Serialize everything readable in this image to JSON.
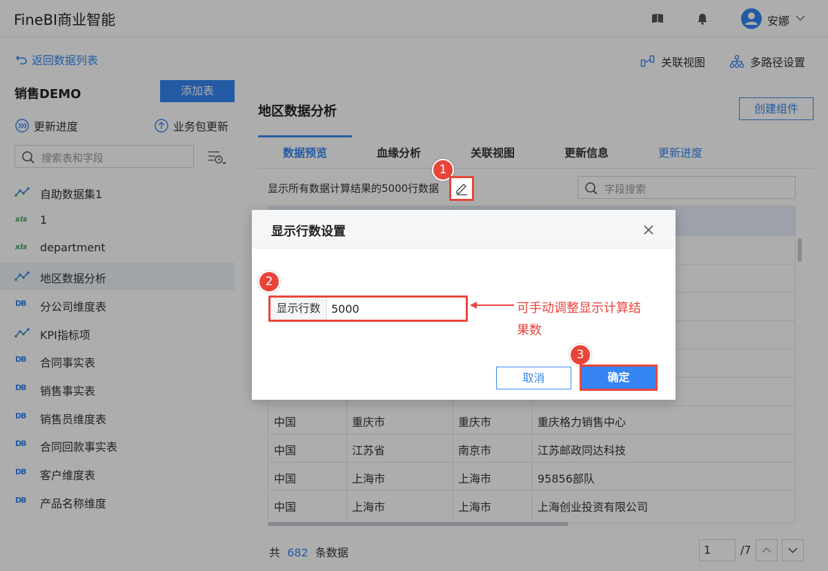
{
  "app": {
    "brand": "FineBI商业智能",
    "user": "安娜"
  },
  "subbar": {
    "back_label": "返回数据列表",
    "relation_view": "关联视图",
    "multipath": "多路径设置"
  },
  "sidebar": {
    "package_title": "销售DEMO",
    "add_table": "添加表",
    "update_progress": "更新进度",
    "package_update": "业务包更新",
    "search_placeholder": "搜索表和字段",
    "items": [
      {
        "label": "自助数据集1",
        "type": "dataset"
      },
      {
        "label": "1",
        "type": "xls"
      },
      {
        "label": "department",
        "type": "xls"
      },
      {
        "label": "地区数据分析",
        "type": "dataset"
      },
      {
        "label": "分公司维度表",
        "type": "db"
      },
      {
        "label": "KPI指标项",
        "type": "dataset"
      },
      {
        "label": "合同事实表",
        "type": "db"
      },
      {
        "label": "销售事实表",
        "type": "db"
      },
      {
        "label": "销售员维度表",
        "type": "db"
      },
      {
        "label": "合同回款事实表",
        "type": "db"
      },
      {
        "label": "客户维度表",
        "type": "db"
      },
      {
        "label": "产品名称维度",
        "type": "db"
      }
    ],
    "type_labels": {
      "xls": "xls",
      "db": "DB"
    },
    "active_index": 3
  },
  "main": {
    "title": "地区数据分析",
    "create_component": "创建组件",
    "tabs": [
      "数据预览",
      "血缘分析",
      "关联视图",
      "更新信息",
      "更新进度"
    ],
    "preview_text": "显示所有数据计算结果的5000行数据",
    "field_search_placeholder": "字段搜索",
    "rows": [
      [
        "中国",
        "重庆市",
        "重庆市",
        "重庆格力销售中心"
      ],
      [
        "中国",
        "江苏省",
        "南京市",
        "江苏邮政同达科技"
      ],
      [
        "中国",
        "上海市",
        "上海市",
        "95856部队"
      ],
      [
        "中国",
        "上海市",
        "上海市",
        "上海创业投资有限公司"
      ]
    ],
    "footer": {
      "prefix": "共",
      "count": "682",
      "suffix": "条数据",
      "page": "1",
      "page_total": "/7"
    }
  },
  "modal": {
    "title": "显示行数设置",
    "field_label": "显示行数",
    "field_value": "5000",
    "annotation": "可手动调整显示计算结果数",
    "cancel": "取消",
    "ok": "确定"
  },
  "steps": [
    "1",
    "2",
    "3"
  ],
  "colors": {
    "accent": "#3685f2",
    "highlight": "#e8443a"
  }
}
